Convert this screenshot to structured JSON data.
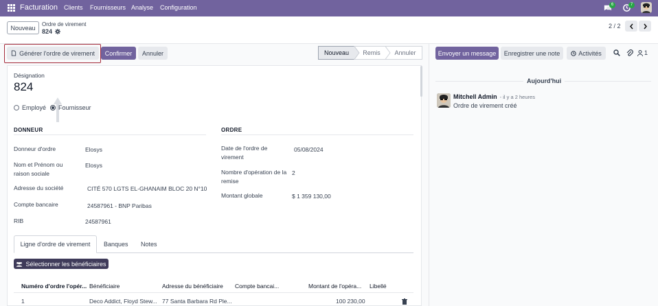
{
  "topbar": {
    "app_name": "Facturation",
    "menu": [
      "Clients",
      "Fournisseurs",
      "Analyse",
      "Configuration"
    ],
    "messages_badge": "6",
    "activities_badge": "7"
  },
  "control_panel": {
    "new_button": "Nouveau",
    "breadcrumb_parent": "Ordre de virement",
    "breadcrumb_current": "824",
    "pager": "2 / 2"
  },
  "actions": {
    "generate": "Générer l'ordre de virement",
    "confirm": "Confirmer",
    "cancel": "Annuler"
  },
  "statusbar": {
    "stages": [
      "Nouveau",
      "Remis",
      "Annuler"
    ],
    "active": "Nouveau"
  },
  "form": {
    "designation_label": "Désignation",
    "designation_value": "824",
    "radio_employee": "Employé",
    "radio_supplier": "Fournisseur",
    "section_left": "DONNEUR",
    "section_right": "ORDRE",
    "fields_left": [
      {
        "label": "Donneur d'ordre",
        "value": "Elosys"
      },
      {
        "label": "Nom et Prénom ou raison sociale",
        "value": "Elosys"
      },
      {
        "label": "Adresse du société",
        "value": "CITÉ 570 LGTS EL-GHANAIM BLOC 20 N°10"
      },
      {
        "label": "Compte bancaire",
        "value": "24587961 - BNP Paribas"
      },
      {
        "label": "RIB",
        "value": "24587961"
      }
    ],
    "fields_right": [
      {
        "label": "Date de l'ordre de virement",
        "value": "05/08/2024"
      },
      {
        "label": "Nombre d'opération de la remise",
        "value": "2"
      },
      {
        "label": "Montant globale",
        "value": "$ 1 359 130,00"
      }
    ]
  },
  "tabs": [
    "Ligne d'ordre de virement",
    "Banques",
    "Notes"
  ],
  "select_beneficiaries": "Sélectionner les bénéficiaires",
  "table": {
    "columns": [
      "Numéro d'ordre l'opér...",
      "Bénéficiaire",
      "Adresse du bénéficiaire",
      "Compte bancai...",
      "Montant de l'opéra...",
      "Libellé"
    ],
    "rows": [
      {
        "num": "1",
        "beneficiary": "Deco Addict, Floyd Stew...",
        "address": "77 Santa Barbara Rd Ple...",
        "account": "",
        "amount": "100 230,00",
        "label": ""
      }
    ]
  },
  "chatter": {
    "send_message": "Envoyer un message",
    "log_note": "Enregistrer une note",
    "activities": "Activités",
    "followers_count": "1",
    "date_separator": "Aujourd'hui",
    "author": "Mitchell Admin",
    "time": "- il y a 2 heures",
    "body": "Ordre de virement créé"
  },
  "colors": {
    "brand": "#71639e",
    "highlight_border": "#a52a3a"
  }
}
